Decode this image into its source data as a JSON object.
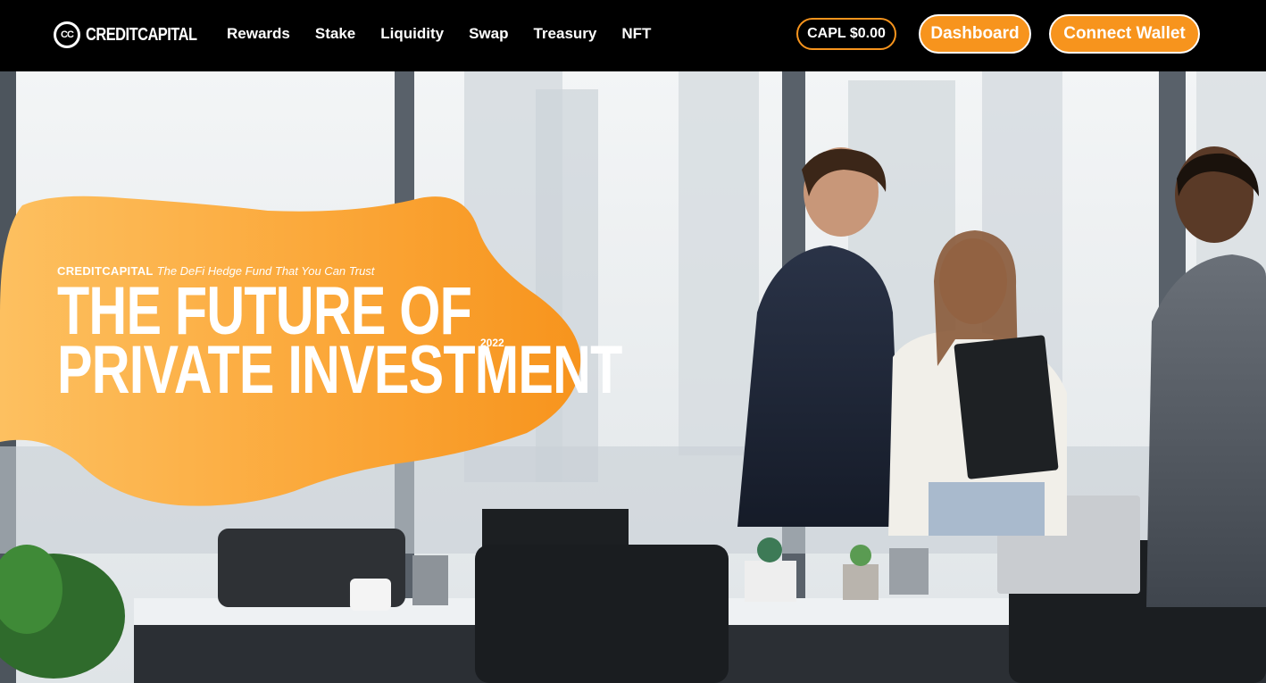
{
  "brand": {
    "logo_mark": "CC",
    "name": "CREDITCAPITAL"
  },
  "nav": {
    "links": [
      "Rewards",
      "Stake",
      "Liquidity",
      "Swap",
      "Treasury",
      "NFT"
    ]
  },
  "header": {
    "price": "CAPL $0.00",
    "dashboard_label": "Dashboard",
    "connect_label": "Connect Wallet"
  },
  "hero": {
    "eyebrow_brand": "CREDITCAPITAL",
    "eyebrow_tagline": "The DeFi Hedge Fund That You Can Trust",
    "headline_line1": "THE FUTURE OF",
    "headline_line2": "PRIVATE INVESTMENT",
    "year": "2022"
  },
  "colors": {
    "accent": "#f7941d",
    "blob_light": "#fdbb55",
    "nav_bg": "#000000"
  },
  "icons": {
    "logo": "cc-logo-icon"
  }
}
